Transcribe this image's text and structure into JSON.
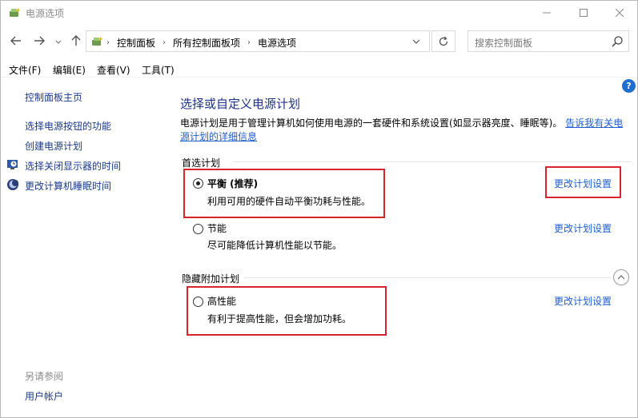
{
  "window": {
    "title": "电源选项"
  },
  "nav": {
    "breadcrumbs": [
      "控制面板",
      "所有控制面板项",
      "电源选项"
    ],
    "search_placeholder": "搜索控制面板"
  },
  "menu": [
    "文件(F)",
    "编辑(E)",
    "查看(V)",
    "工具(T)"
  ],
  "sidebar": {
    "home": "控制面板主页",
    "links": [
      "选择电源按钮的功能",
      "创建电源计划",
      "选择关闭显示器的时间",
      "更改计算机睡眠时间"
    ],
    "see_also_title": "另请参阅",
    "see_also_links": [
      "用户帐户"
    ]
  },
  "main": {
    "title": "选择或自定义电源计划",
    "description": "电源计划是用于管理计算机如何使用电源的一套硬件和系统设置(如显示器亮度、睡眠等)。",
    "description_link": "告诉我有关电源计划的详细信息",
    "preferred_heading": "首选计划",
    "hidden_heading": "隐藏附加计划",
    "plans": [
      {
        "name": "平衡 (推荐)",
        "desc": "利用可用的硬件自动平衡功耗与性能。",
        "link": "更改计划设置",
        "selected": true
      },
      {
        "name": "节能",
        "desc": "尽可能降低计算机性能以节能。",
        "link": "更改计划设置",
        "selected": false
      },
      {
        "name": "高性能",
        "desc": "有利于提高性能，但会增加功耗。",
        "link": "更改计划设置",
        "selected": false
      }
    ]
  },
  "colors": {
    "link": "#1f5ed1",
    "title": "#1e3287",
    "highlight_box": "#d9232d"
  }
}
